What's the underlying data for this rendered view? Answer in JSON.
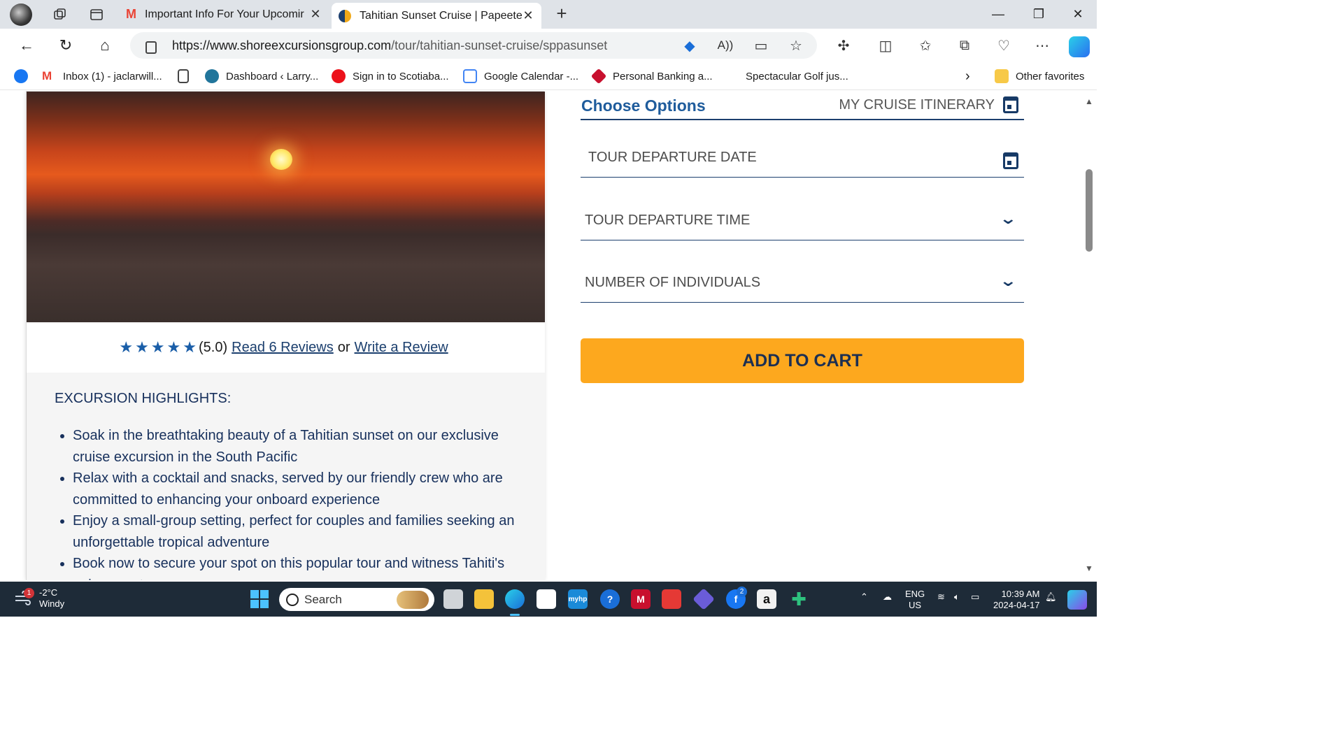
{
  "browser": {
    "tabs": [
      {
        "title": "Important Info For Your Upcomir",
        "favicon": "gmail-icon"
      },
      {
        "title": "Tahitian Sunset Cruise | Papeete S",
        "favicon": "shore-excursions-icon",
        "active": true
      }
    ],
    "url_host": "https://www.shoreexcursionsgroup.com",
    "url_path": "/tour/tahitian-sunset-cruise/sppasunset",
    "favorites": [
      {
        "label": "",
        "icon": "facebook-icon",
        "color": "#1877f2"
      },
      {
        "label": "Inbox (1) - jaclarwill...",
        "icon": "gmail-icon",
        "color": "#ea4335"
      },
      {
        "label": "",
        "icon": "page-icon",
        "color": "#444444"
      },
      {
        "label": "Dashboard ‹ Larry...",
        "icon": "wordpress-icon",
        "color": "#21759b"
      },
      {
        "label": "Sign in to Scotiaba...",
        "icon": "scotiabank-icon",
        "color": "#ec111a"
      },
      {
        "label": "Google Calendar -...",
        "icon": "google-calendar-icon",
        "color": "#4285f4"
      },
      {
        "label": "Personal Banking a...",
        "icon": "bank-icon",
        "color": "#c8102e"
      },
      {
        "label": "Spectacular Golf jus...",
        "icon": "golf-icon",
        "color": "#ffffff"
      }
    ],
    "other_favorites": "Other favorites"
  },
  "page": {
    "rating": "(5.0)",
    "stars": 5,
    "read_reviews": "Read 6 Reviews",
    "or_text": "or",
    "write_review": "Write a Review",
    "highlights_title": "EXCURSION HIGHLIGHTS:",
    "highlights": [
      "Soak in the breathtaking beauty of a Tahitian sunset on our exclusive cruise excursion in the South Pacific",
      "Relax with a cocktail and snacks, served by our friendly crew who are committed to enhancing your onboard experience",
      "Enjoy a small-group setting, perfect for couples and families seeking an unforgettable tropical adventure",
      "Book now to secure your spot on this popular tour and witness Tahiti's epic sunset"
    ],
    "choose_options": "Choose Options",
    "my_cruise_itinerary": "MY CRUISE ITINERARY",
    "departure_date_label": "TOUR DEPARTURE DATE",
    "departure_time_label": "TOUR DEPARTURE TIME",
    "individuals_label": "NUMBER OF INDIVIDUALS",
    "add_to_cart": "ADD TO CART",
    "accent_color": "#fda81e",
    "heading_color": "#1f5c9c"
  },
  "taskbar": {
    "weather_temp": "-2°C",
    "weather_desc": "Windy",
    "weather_badge": "1",
    "search_placeholder": "Search",
    "facebook_badge": "2",
    "lang_top": "ENG",
    "lang_bottom": "US",
    "time": "10:39 AM",
    "date": "2024-04-17"
  }
}
